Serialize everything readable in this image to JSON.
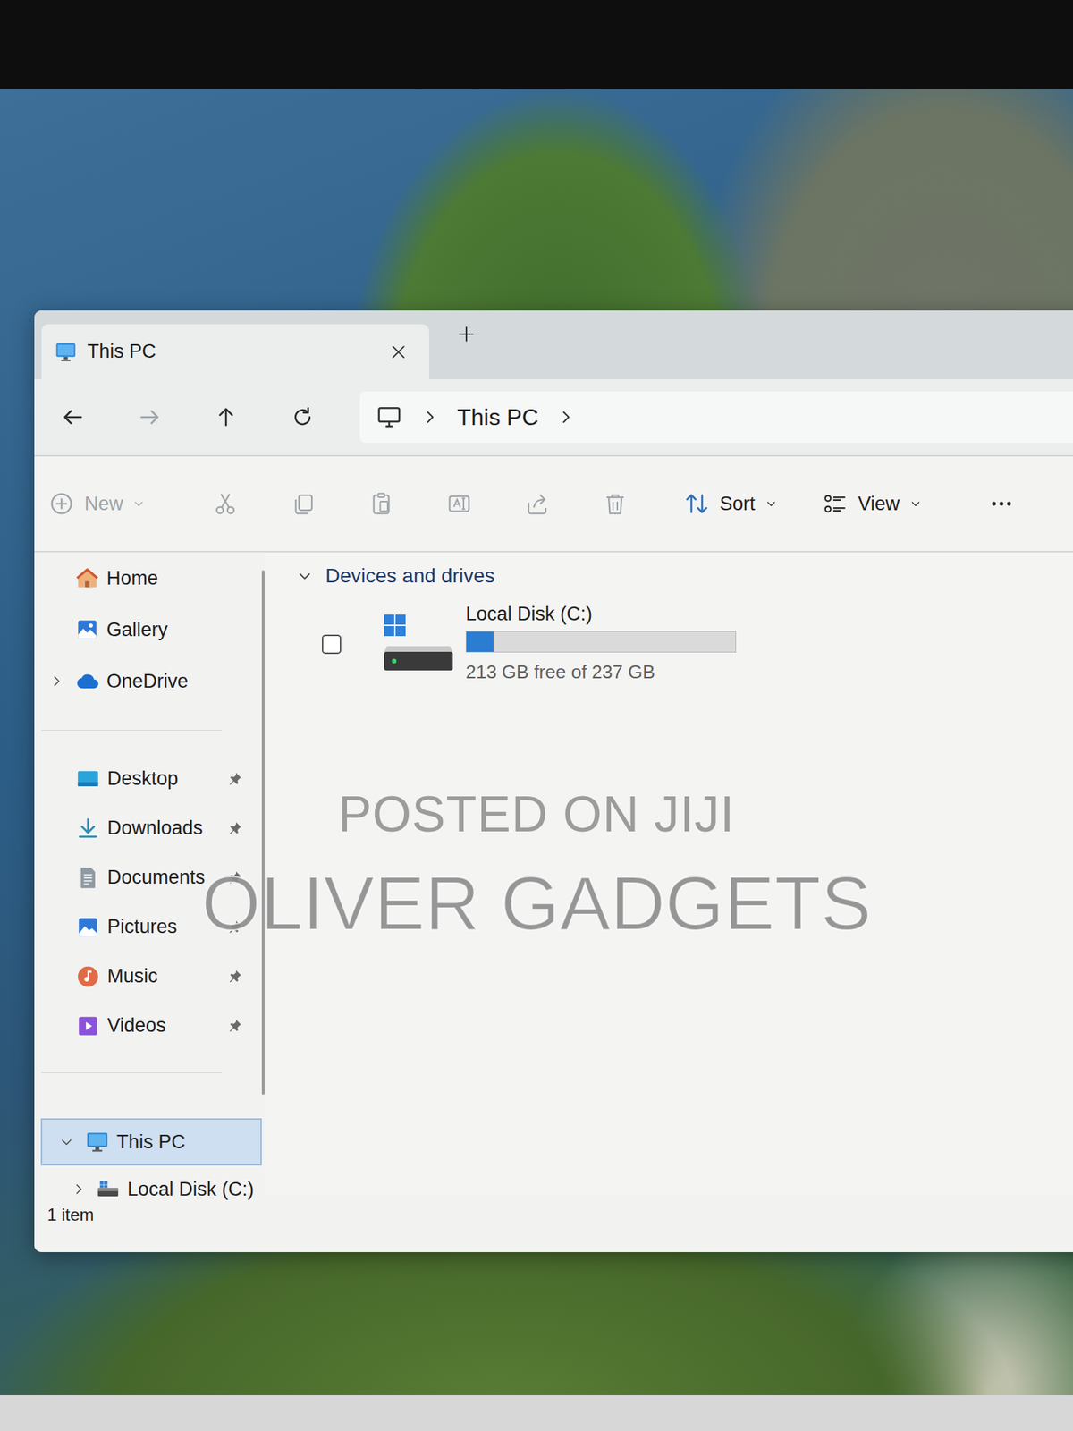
{
  "window": {
    "title": "This PC"
  },
  "nav": [
    {
      "disabled": false
    },
    {
      "disabled": true
    },
    {
      "disabled": false
    },
    {
      "disabled": false
    }
  ],
  "breadcrumb": [
    "This PC"
  ],
  "toolbar": [
    {
      "label": "New",
      "disabled": true
    },
    {
      "disabled": true
    },
    {
      "disabled": true
    },
    {
      "disabled": true
    },
    {
      "disabled": true
    },
    {
      "disabled": true
    },
    {
      "disabled": true
    },
    {
      "label": "Sort",
      "disabled": false
    },
    {
      "label": "View",
      "disabled": false
    },
    {
      "disabled": false
    }
  ],
  "sidebar": {
    "top": [
      {
        "label": "Home",
        "selected": false
      },
      {
        "label": "Gallery",
        "selected": false
      },
      {
        "label": "OneDrive",
        "selected": false,
        "expanded": false
      }
    ],
    "quick_access": [
      {
        "label": "Desktop",
        "selected": false,
        "pinned": true
      },
      {
        "label": "Downloads",
        "selected": false,
        "pinned": true
      },
      {
        "label": "Documents",
        "selected": false,
        "pinned": true
      },
      {
        "label": "Pictures",
        "selected": false,
        "pinned": true
      },
      {
        "label": "Music",
        "selected": false,
        "pinned": true
      },
      {
        "label": "Videos",
        "selected": false,
        "pinned": true
      }
    ],
    "tree": [
      {
        "label": "This PC",
        "selected": true,
        "expanded": true
      },
      {
        "label": "Local Disk (C:)",
        "selected": false,
        "expanded": false
      }
    ]
  },
  "content": {
    "group": {
      "label": "Devices and drives",
      "expanded": true
    },
    "drives": [
      {
        "name": "Local Disk (C:)",
        "free": "213 GB free of 237 GB",
        "level": 0.1,
        "checked": false
      }
    ]
  },
  "status_bar": "1 item",
  "watermark": [
    "POSTED ON JIJI",
    "OLIVER GADGETS"
  ]
}
